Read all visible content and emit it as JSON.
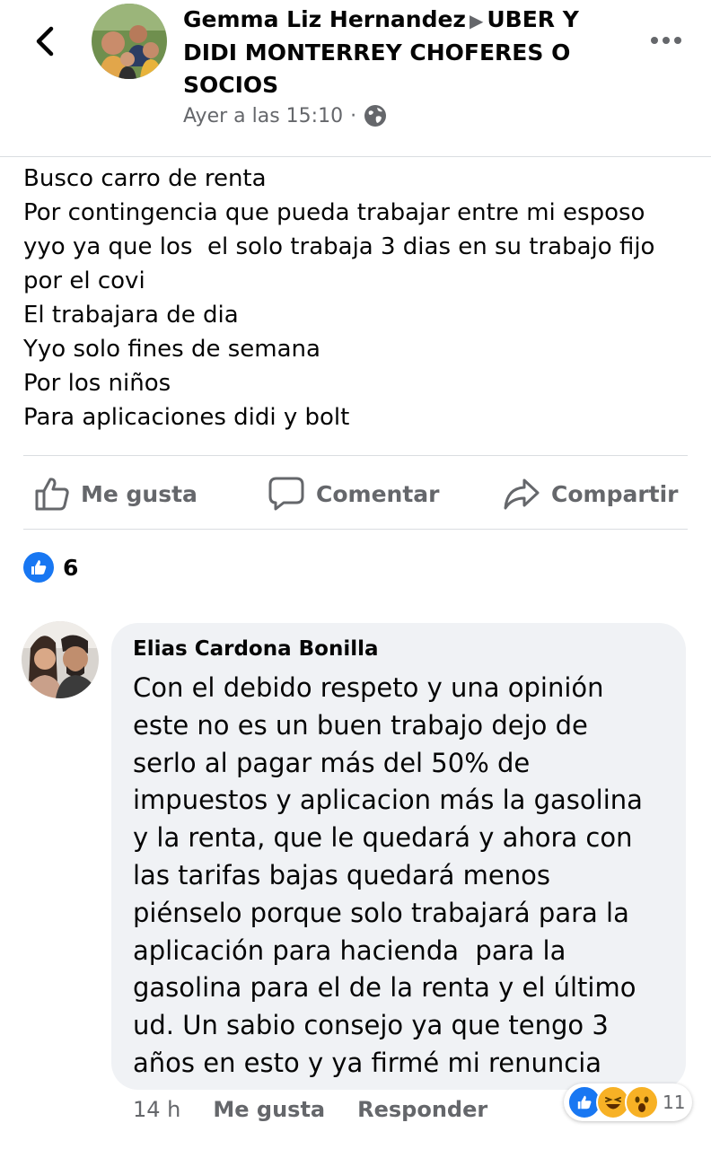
{
  "header": {
    "author": "Gemma Liz Hernandez",
    "group": "UBER Y DIDI MONTERREY CHOFERES O SOCIOS",
    "timestamp": "Ayer a las 15:10",
    "separator": "·"
  },
  "post": {
    "lines": [
      "Busco carro de renta",
      "Por contingencia que pueda trabajar entre mi esposo",
      "yyo ya que los  el solo trabaja 3 dias en su trabajo fijo",
      "por el covi",
      "El trabajara de dia",
      "Yyo solo fines de semana",
      "Por los niños",
      "Para aplicaciones didi y bolt"
    ]
  },
  "actions": {
    "like": "Me gusta",
    "comment": "Comentar",
    "share": "Compartir"
  },
  "reactions": {
    "count": "6"
  },
  "comment": {
    "author": "Elias Cardona Bonilla",
    "lines": [
      "Con el debido respeto y una opinión",
      "este no es un buen trabajo dejo de",
      "serlo al pagar más del 50% de",
      "impuestos y aplicacion más la gasolina",
      "y la renta, que le quedará y ahora con",
      "las tarifas bajas quedará menos",
      "piénselo porque solo trabajará para la",
      "aplicación para hacienda  para la",
      "gasolina para el de la renta y el último",
      "ud. Un sabio consejo ya que tengo 3",
      "años en esto y ya firmé mi renuncia"
    ],
    "time": "14 h",
    "like": "Me gusta",
    "reply": "Responder",
    "reaction_count": "11"
  },
  "colors": {
    "brand_blue": "#1877f2",
    "secondary_text": "#65676b",
    "bubble_bg": "#f0f2f5",
    "divider": "#dadde1"
  },
  "icons": {
    "back": "chevron-left-icon",
    "more": "more-horizontal-icon",
    "privacy": "globe-icon",
    "like": "thumbs-up-icon",
    "comment": "speech-bubble-icon",
    "share": "share-arrow-icon"
  }
}
